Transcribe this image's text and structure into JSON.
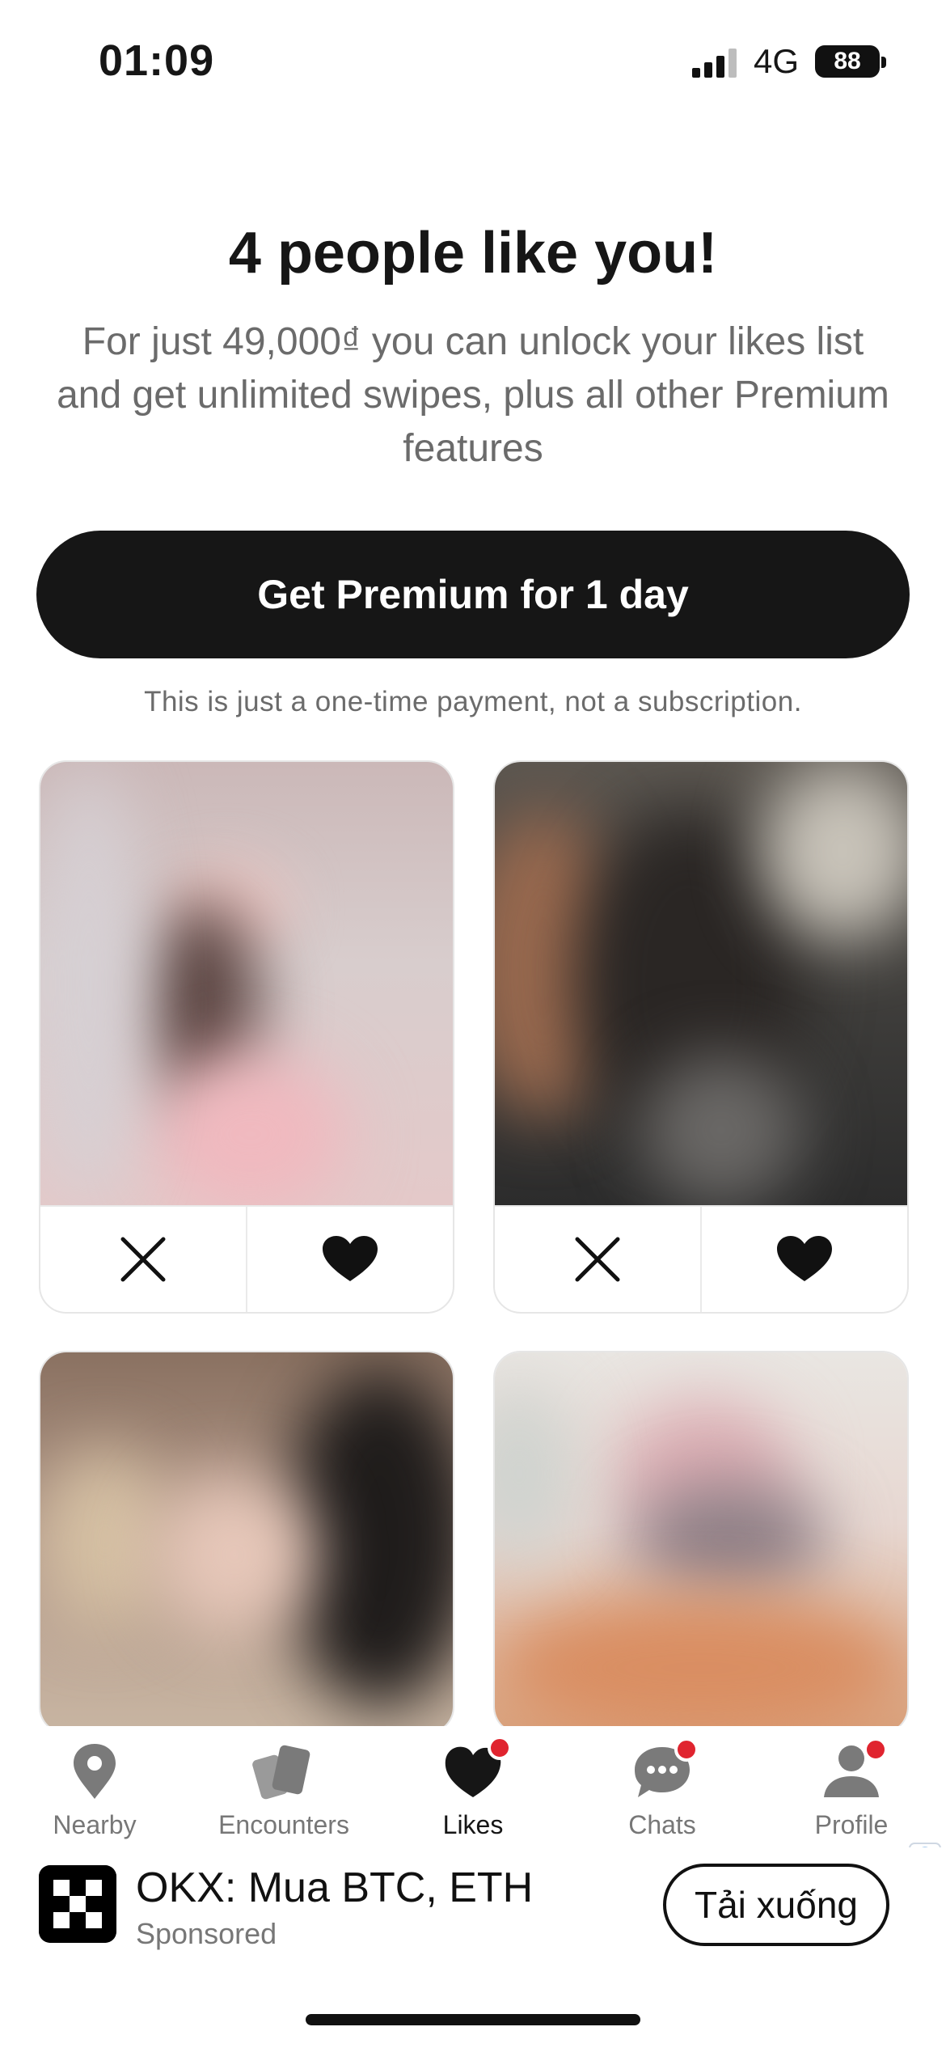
{
  "status_bar": {
    "time": "01:09",
    "network": "4G",
    "battery": "88"
  },
  "header": {
    "title": "4 people like you!",
    "subtitle": "For just 49,000₫ you can unlock your likes list and get unlimited swipes, plus all other Premium features"
  },
  "cta": {
    "button_label": "Get Premium for 1 day",
    "note": "This is just a one-time payment, not a subscription."
  },
  "cards": [
    {
      "image": "blurred-profile-photo",
      "actions": [
        "close-icon",
        "heart-icon"
      ]
    },
    {
      "image": "blurred-profile-photo",
      "actions": [
        "close-icon",
        "heart-icon"
      ]
    },
    {
      "image": "blurred-profile-photo"
    },
    {
      "image": "blurred-profile-photo"
    }
  ],
  "tabs": [
    {
      "label": "Nearby",
      "icon": "location-pin-icon",
      "badge": false
    },
    {
      "label": "Encounters",
      "icon": "cards-icon",
      "badge": false
    },
    {
      "label": "Likes",
      "icon": "heart-icon",
      "badge": true,
      "active": true
    },
    {
      "label": "Chats",
      "icon": "chat-bubble-icon",
      "badge": true
    },
    {
      "label": "Profile",
      "icon": "person-icon",
      "badge": true
    }
  ],
  "ad": {
    "title": "OKX: Mua BTC, ETH",
    "sponsored": "Sponsored",
    "button": "Tải xuống"
  },
  "colors": {
    "primary": "#161616",
    "badge": "#e0242f",
    "muted": "#6b6b6b"
  }
}
